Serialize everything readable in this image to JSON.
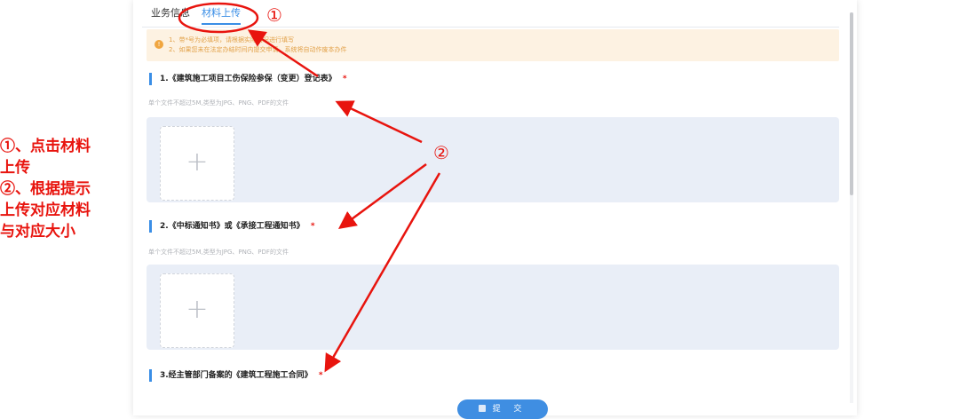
{
  "guide": {
    "lines": [
      "①、点击材料",
      "上传",
      "②、根据提示",
      "上传对应材料",
      "与对应大小"
    ]
  },
  "tabs": [
    {
      "label": "业务信息",
      "active": false
    },
    {
      "label": "材料上传",
      "active": true
    }
  ],
  "notice": {
    "icon": "warning-icon",
    "lines": [
      "1、带*号为必填项，请根据实际情况进行填写",
      "2、如果您未在法定办结时间内提交申请，系统将自动作废本办件"
    ]
  },
  "sections": [
    {
      "title": "1.《建筑施工项目工伤保险参保（变更）登记表》",
      "required_mark": "*",
      "hint": "单个文件不超过5M,类型为JPG、PNG、PDF的文件",
      "upload_symbol": "+"
    },
    {
      "title": "2.《中标通知书》或《承接工程通知书》",
      "required_mark": "*",
      "hint": "单个文件不超过5M,类型为JPG、PNG、PDF的文件",
      "upload_symbol": "+"
    },
    {
      "title": "3.经主管部门备案的《建筑工程施工合同》",
      "required_mark": "*"
    }
  ],
  "submit": {
    "label": "提 交",
    "icon": "clipboard-icon"
  },
  "annotations": {
    "marker1": "①",
    "marker2": "②",
    "color": "#e8140e"
  },
  "colors": {
    "accent": "#3a8ee6",
    "notice_bg": "#fdf2e2",
    "upload_bg": "#e9eef7",
    "required": "#e8140e"
  }
}
